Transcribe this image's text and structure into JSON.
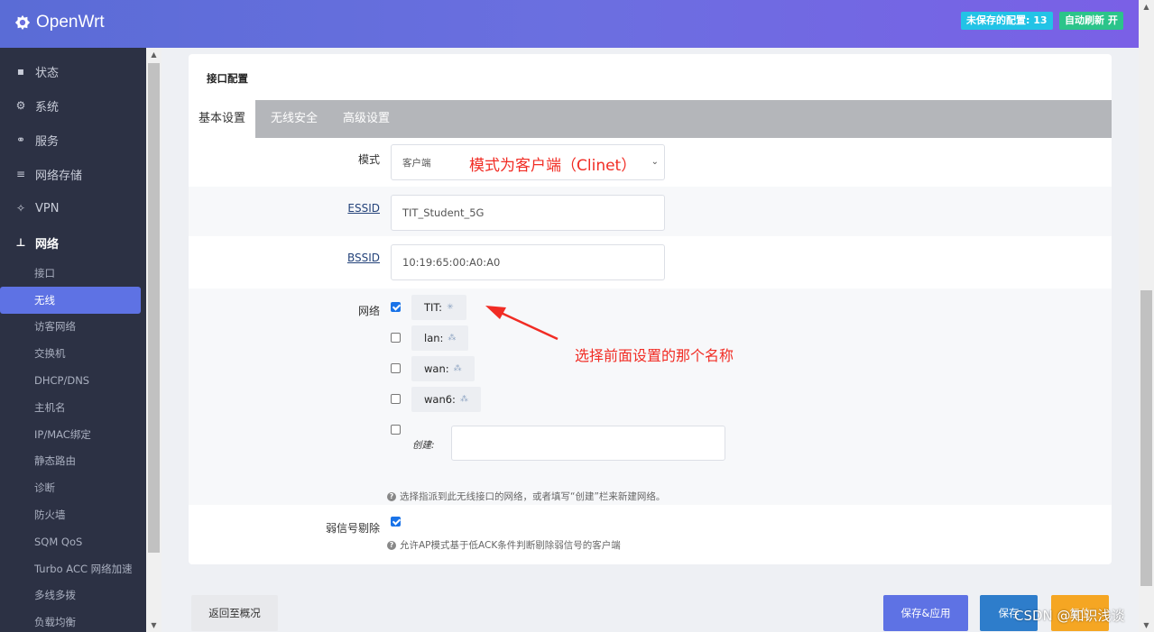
{
  "header": {
    "brand": "OpenWrt",
    "unsaved_label": "未保存的配置: 13",
    "refresh_label": "自动刷新 开"
  },
  "sidebar": {
    "top_items": [
      {
        "label": "状态",
        "icon": "dashboard-icon"
      },
      {
        "label": "系统",
        "icon": "gear-icon"
      },
      {
        "label": "服务",
        "icon": "services-icon"
      },
      {
        "label": "网络存储",
        "icon": "database-icon"
      },
      {
        "label": "VPN",
        "icon": "vpn-icon"
      },
      {
        "label": "网络",
        "icon": "network-icon"
      }
    ],
    "sub_items": [
      "接口",
      "无线",
      "访客网络",
      "交换机",
      "DHCP/DNS",
      "主机名",
      "IP/MAC绑定",
      "静态路由",
      "诊断",
      "防火墙",
      "SQM QoS",
      "Turbo ACC 网络加速",
      "多线多拨",
      "负载均衡"
    ]
  },
  "card": {
    "title": "接口配置",
    "tabs": [
      "基本设置",
      "无线安全",
      "高级设置"
    ],
    "mode": {
      "label": "模式",
      "value": "客户端"
    },
    "essid": {
      "label": "ESSID",
      "value": "TIT_Student_5G"
    },
    "bssid": {
      "label": "BSSID",
      "value": "10:19:65:00:A0:A0"
    },
    "network": {
      "label": "网络",
      "options": [
        {
          "name": "TIT:",
          "checked": true
        },
        {
          "name": "lan:",
          "checked": false
        },
        {
          "name": "wan:",
          "checked": false
        },
        {
          "name": "wan6:",
          "checked": false
        }
      ],
      "create_label": "创建:",
      "create_value": "",
      "hint": "选择指派到此无线接口的网络，或者填写“创建”栏来新建网络。"
    },
    "weak": {
      "label": "弱信号剔除",
      "checked": true,
      "hint": "允许AP模式基于低ACK条件判断剔除弱信号的客户端"
    }
  },
  "annotations": {
    "mode_note": "模式为客户端（Clinet）",
    "network_note": "选择前面设置的那个名称",
    "arrow_color": "#f12c24"
  },
  "footer": {
    "back": "返回至概况",
    "save_apply": "保存&应用",
    "save": "保存",
    "reset": "复位"
  },
  "watermark": "CSDN @知识浅谈"
}
